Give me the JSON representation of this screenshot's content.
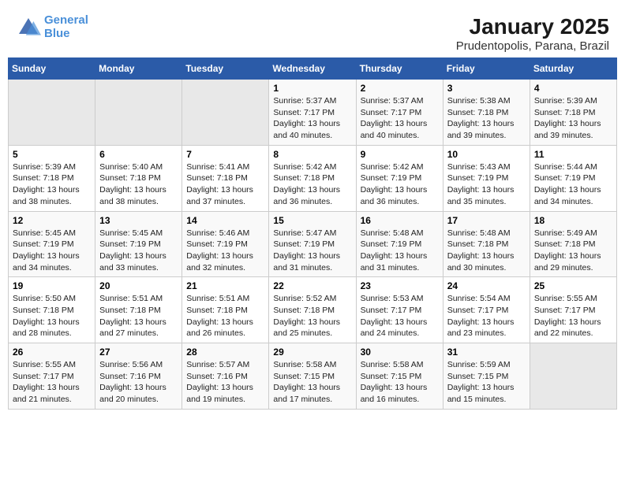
{
  "header": {
    "logo_line1": "General",
    "logo_line2": "Blue",
    "title": "January 2025",
    "subtitle": "Prudentopolis, Parana, Brazil"
  },
  "days_of_week": [
    "Sunday",
    "Monday",
    "Tuesday",
    "Wednesday",
    "Thursday",
    "Friday",
    "Saturday"
  ],
  "weeks": [
    [
      {
        "day": "",
        "sunrise": "",
        "sunset": "",
        "daylight": ""
      },
      {
        "day": "",
        "sunrise": "",
        "sunset": "",
        "daylight": ""
      },
      {
        "day": "",
        "sunrise": "",
        "sunset": "",
        "daylight": ""
      },
      {
        "day": "1",
        "sunrise": "Sunrise: 5:37 AM",
        "sunset": "Sunset: 7:17 PM",
        "daylight": "Daylight: 13 hours and 40 minutes."
      },
      {
        "day": "2",
        "sunrise": "Sunrise: 5:37 AM",
        "sunset": "Sunset: 7:17 PM",
        "daylight": "Daylight: 13 hours and 40 minutes."
      },
      {
        "day": "3",
        "sunrise": "Sunrise: 5:38 AM",
        "sunset": "Sunset: 7:18 PM",
        "daylight": "Daylight: 13 hours and 39 minutes."
      },
      {
        "day": "4",
        "sunrise": "Sunrise: 5:39 AM",
        "sunset": "Sunset: 7:18 PM",
        "daylight": "Daylight: 13 hours and 39 minutes."
      }
    ],
    [
      {
        "day": "5",
        "sunrise": "Sunrise: 5:39 AM",
        "sunset": "Sunset: 7:18 PM",
        "daylight": "Daylight: 13 hours and 38 minutes."
      },
      {
        "day": "6",
        "sunrise": "Sunrise: 5:40 AM",
        "sunset": "Sunset: 7:18 PM",
        "daylight": "Daylight: 13 hours and 38 minutes."
      },
      {
        "day": "7",
        "sunrise": "Sunrise: 5:41 AM",
        "sunset": "Sunset: 7:18 PM",
        "daylight": "Daylight: 13 hours and 37 minutes."
      },
      {
        "day": "8",
        "sunrise": "Sunrise: 5:42 AM",
        "sunset": "Sunset: 7:18 PM",
        "daylight": "Daylight: 13 hours and 36 minutes."
      },
      {
        "day": "9",
        "sunrise": "Sunrise: 5:42 AM",
        "sunset": "Sunset: 7:19 PM",
        "daylight": "Daylight: 13 hours and 36 minutes."
      },
      {
        "day": "10",
        "sunrise": "Sunrise: 5:43 AM",
        "sunset": "Sunset: 7:19 PM",
        "daylight": "Daylight: 13 hours and 35 minutes."
      },
      {
        "day": "11",
        "sunrise": "Sunrise: 5:44 AM",
        "sunset": "Sunset: 7:19 PM",
        "daylight": "Daylight: 13 hours and 34 minutes."
      }
    ],
    [
      {
        "day": "12",
        "sunrise": "Sunrise: 5:45 AM",
        "sunset": "Sunset: 7:19 PM",
        "daylight": "Daylight: 13 hours and 34 minutes."
      },
      {
        "day": "13",
        "sunrise": "Sunrise: 5:45 AM",
        "sunset": "Sunset: 7:19 PM",
        "daylight": "Daylight: 13 hours and 33 minutes."
      },
      {
        "day": "14",
        "sunrise": "Sunrise: 5:46 AM",
        "sunset": "Sunset: 7:19 PM",
        "daylight": "Daylight: 13 hours and 32 minutes."
      },
      {
        "day": "15",
        "sunrise": "Sunrise: 5:47 AM",
        "sunset": "Sunset: 7:19 PM",
        "daylight": "Daylight: 13 hours and 31 minutes."
      },
      {
        "day": "16",
        "sunrise": "Sunrise: 5:48 AM",
        "sunset": "Sunset: 7:19 PM",
        "daylight": "Daylight: 13 hours and 31 minutes."
      },
      {
        "day": "17",
        "sunrise": "Sunrise: 5:48 AM",
        "sunset": "Sunset: 7:18 PM",
        "daylight": "Daylight: 13 hours and 30 minutes."
      },
      {
        "day": "18",
        "sunrise": "Sunrise: 5:49 AM",
        "sunset": "Sunset: 7:18 PM",
        "daylight": "Daylight: 13 hours and 29 minutes."
      }
    ],
    [
      {
        "day": "19",
        "sunrise": "Sunrise: 5:50 AM",
        "sunset": "Sunset: 7:18 PM",
        "daylight": "Daylight: 13 hours and 28 minutes."
      },
      {
        "day": "20",
        "sunrise": "Sunrise: 5:51 AM",
        "sunset": "Sunset: 7:18 PM",
        "daylight": "Daylight: 13 hours and 27 minutes."
      },
      {
        "day": "21",
        "sunrise": "Sunrise: 5:51 AM",
        "sunset": "Sunset: 7:18 PM",
        "daylight": "Daylight: 13 hours and 26 minutes."
      },
      {
        "day": "22",
        "sunrise": "Sunrise: 5:52 AM",
        "sunset": "Sunset: 7:18 PM",
        "daylight": "Daylight: 13 hours and 25 minutes."
      },
      {
        "day": "23",
        "sunrise": "Sunrise: 5:53 AM",
        "sunset": "Sunset: 7:17 PM",
        "daylight": "Daylight: 13 hours and 24 minutes."
      },
      {
        "day": "24",
        "sunrise": "Sunrise: 5:54 AM",
        "sunset": "Sunset: 7:17 PM",
        "daylight": "Daylight: 13 hours and 23 minutes."
      },
      {
        "day": "25",
        "sunrise": "Sunrise: 5:55 AM",
        "sunset": "Sunset: 7:17 PM",
        "daylight": "Daylight: 13 hours and 22 minutes."
      }
    ],
    [
      {
        "day": "26",
        "sunrise": "Sunrise: 5:55 AM",
        "sunset": "Sunset: 7:17 PM",
        "daylight": "Daylight: 13 hours and 21 minutes."
      },
      {
        "day": "27",
        "sunrise": "Sunrise: 5:56 AM",
        "sunset": "Sunset: 7:16 PM",
        "daylight": "Daylight: 13 hours and 20 minutes."
      },
      {
        "day": "28",
        "sunrise": "Sunrise: 5:57 AM",
        "sunset": "Sunset: 7:16 PM",
        "daylight": "Daylight: 13 hours and 19 minutes."
      },
      {
        "day": "29",
        "sunrise": "Sunrise: 5:58 AM",
        "sunset": "Sunset: 7:15 PM",
        "daylight": "Daylight: 13 hours and 17 minutes."
      },
      {
        "day": "30",
        "sunrise": "Sunrise: 5:58 AM",
        "sunset": "Sunset: 7:15 PM",
        "daylight": "Daylight: 13 hours and 16 minutes."
      },
      {
        "day": "31",
        "sunrise": "Sunrise: 5:59 AM",
        "sunset": "Sunset: 7:15 PM",
        "daylight": "Daylight: 13 hours and 15 minutes."
      },
      {
        "day": "",
        "sunrise": "",
        "sunset": "",
        "daylight": ""
      }
    ]
  ]
}
